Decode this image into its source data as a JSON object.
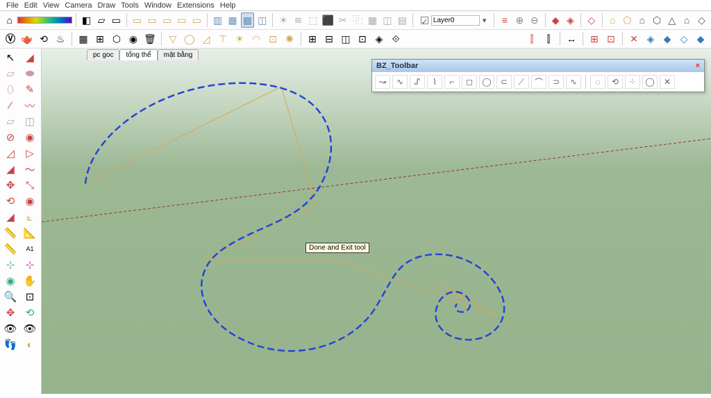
{
  "menu": {
    "file": "File",
    "edit": "Edit",
    "view": "View",
    "camera": "Camera",
    "draw": "Draw",
    "tools": "Tools",
    "window": "Window",
    "extensions": "Extensions",
    "help": "Help"
  },
  "layer": {
    "checked": "✓",
    "name": "Layer0"
  },
  "scenes": {
    "t1": "pc goc",
    "t2": "tổng thể",
    "t3": "mặt bằng"
  },
  "bz": {
    "title": "BZ_Toolbar",
    "close": "×",
    "btns": {
      "b1": "↝",
      "b2": "∿",
      "b3": "ᔑ",
      "b4": "⌇",
      "b5": "⌐",
      "b6": "◻",
      "b7": "◯",
      "b8": "⊂",
      "b9": "⟋",
      "b10": "⌒",
      "b11": "⊃",
      "b12": "∿",
      "b13": "◌",
      "b14": "⟲",
      "b15": "⁘",
      "b16": "◯",
      "b17": "✕"
    }
  },
  "tooltip": {
    "text": "Done and Exit tool"
  },
  "tb1": {
    "home": "⌂",
    "erase": "◧",
    "wire": "▱",
    "hid": "▭",
    "shade1": "▥",
    "shade2": "▦",
    "tex": "▩",
    "mono": "◫",
    "box": "▭",
    "sun": "☀",
    "fog": "≋",
    "orbit": "⟲",
    "pan": "✥",
    "zoom": "🔍",
    "zoome": "⤢",
    "prev": "↶",
    "next": "↷",
    "sel": "⬚",
    "sel2": "⬛",
    "cut": "✂",
    "copy": "⿻",
    "paste": "📋",
    "undo": "↶",
    "redo": "↷",
    "dim1": "⊕",
    "dim2": "⊖",
    "sec1": "▦",
    "sec2": "◫",
    "sec3": "▤",
    "align": "≡",
    "solid1": "◆",
    "solid2": "◈",
    "solid3": "◇",
    "h1": "⌂",
    "h2": "⬠",
    "h3": "⬡",
    "h4": "△",
    "h5": "◇"
  },
  "tb2": {
    "v": "Ⓥ",
    "tea": "🫖",
    "flip": "⟲",
    "heat": "♨",
    "grid": "▦",
    "win": "⊞",
    "hex": "⬡",
    "stove": "◉",
    "bin": "🗑",
    "y1": "▽",
    "y2": "◯",
    "y3": "◿",
    "y4": "⊤",
    "y5": "☀",
    "y6": "◠",
    "y7": "⊡",
    "y8": "✺",
    "m1": "⊞",
    "m2": "⊟",
    "m3": "◫",
    "m4": "⊡",
    "m5": "◈",
    "m6": "⟐",
    "a1": "⫿",
    "a2": "⫿",
    "a3": "↔",
    "a4": "⊞",
    "a5": "⊡",
    "a6": "⊟",
    "x1": "✕",
    "x2": "◈",
    "x3": "◆",
    "x4": "◇",
    "x5": "◆"
  },
  "lt": {
    "r1a": "↖",
    "r1b": "◢",
    "r2a": "▱",
    "r2b": "⬬",
    "r3a": "⬯",
    "r3b": "✎",
    "r4a": "∕",
    "r4b": "〰",
    "r5a": "▱",
    "r5b": "◫",
    "r6a": "⊘",
    "r6b": "◉",
    "r7a": "◿",
    "r7b": "▷",
    "r8a": "◢",
    "r8b": "〜",
    "r9a": "✥",
    "r9b": "⤡",
    "r10a": "⟲",
    "r10b": "◉",
    "r11a": "◢",
    "r11b": "⟀",
    "r12a": "📏",
    "r12b": "📐",
    "r13a": "📏",
    "r13b": "A1",
    "r14a": "⊹",
    "r14b": "⊹",
    "r15a": "◉",
    "r15b": "✋",
    "r16a": "🔍",
    "r16b": "⊡",
    "r17a": "✥",
    "r17b": "⟲",
    "r18a": "👁",
    "r18b": "👁",
    "r19a": "👣",
    "r19b": "◐"
  },
  "colors": {
    "blue": "#2544d6",
    "orange": "#d4a857",
    "axis_red": "#a03020"
  }
}
